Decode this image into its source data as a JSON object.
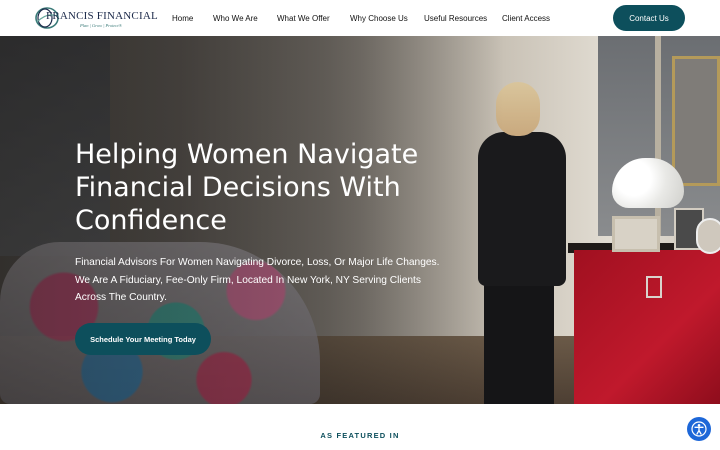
{
  "header": {
    "logo": {
      "name": "FRANCIS FINANCIAL",
      "tagline": "Plan | Grow | Protect®"
    },
    "nav": [
      {
        "label": "Home"
      },
      {
        "label": "Who We Are"
      },
      {
        "label": "What We Offer"
      },
      {
        "label": "Why Choose Us"
      },
      {
        "label": "Useful Resources"
      },
      {
        "label": "Client Access"
      }
    ],
    "contact_label": "Contact Us"
  },
  "hero": {
    "title_lines": [
      "Helping Women Navigate",
      "Financial Decisions With",
      "Confidence"
    ],
    "subtitle_lines": [
      "Financial Advisors For Women Navigating Divorce, Loss, Or Major Life Changes.",
      "We Are A Fiduciary, Fee-Only Firm, Located In New York, NY Serving Clients",
      "Across The Country."
    ],
    "cta_label": "Schedule Your Meeting Today"
  },
  "featured": {
    "heading": "AS FEATURED IN"
  },
  "colors": {
    "brand_teal": "#0d4f5c",
    "accessibility_blue": "#1d67d8"
  },
  "icons": {
    "logo_mark": "francis-financial-logo-mark",
    "accessibility": "accessibility-icon"
  }
}
